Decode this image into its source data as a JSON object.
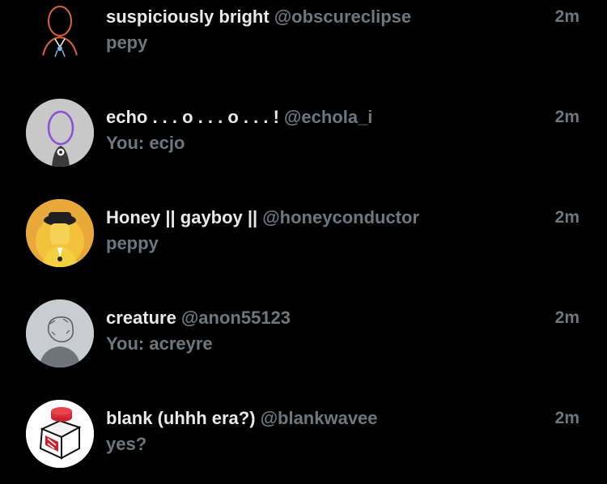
{
  "conversations": [
    {
      "display_name": "suspiciously bright",
      "handle": "@obscureclipse",
      "time": "2m",
      "preview": "pepy",
      "avatar_icon": "orange-line-art-avatar"
    },
    {
      "display_name": "echo . . . o . . . o . . . !",
      "handle": "@echola_i",
      "time": "2m",
      "preview": "You: ecjo",
      "avatar_icon": "purple-outline-avatar"
    },
    {
      "display_name": "Honey || gayboy ||",
      "handle": "@honeyconductor",
      "time": "2m",
      "preview": "peppy",
      "avatar_icon": "yellow-conductor-avatar"
    },
    {
      "display_name": "creature",
      "handle": "@anon55123",
      "time": "2m",
      "preview": "You: acreyre",
      "avatar_icon": "gray-sketch-avatar"
    },
    {
      "display_name": "blank (uhhh era?)",
      "handle": "@blankwavee",
      "time": "2m",
      "preview": "yes?",
      "avatar_icon": "red-cube-avatar"
    }
  ],
  "colors": {
    "background": "#000000",
    "primary_text": "#e7e9ea",
    "secondary_text": "#71767b"
  }
}
